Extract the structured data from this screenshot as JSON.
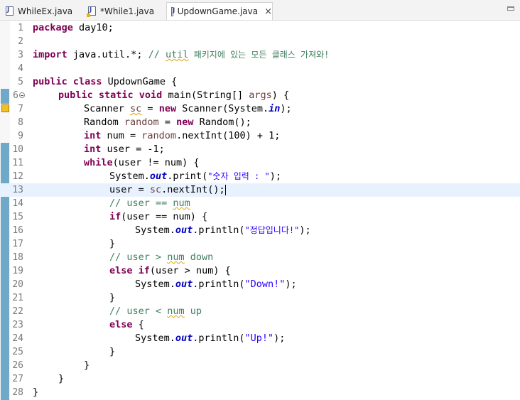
{
  "tabs": [
    {
      "label": "WhileEx.java"
    },
    {
      "label": "*While1.java"
    },
    {
      "label": "UpdownGame.java",
      "close": "×"
    }
  ],
  "lines": [
    "1",
    "2",
    "3",
    "4",
    "5",
    "6",
    "7",
    "8",
    "9",
    "10",
    "11",
    "12",
    "13",
    "14",
    "15",
    "16",
    "17",
    "18",
    "19",
    "20",
    "21",
    "22",
    "23",
    "24",
    "25",
    "26",
    "27",
    "28"
  ],
  "code": {
    "l1_kw": "package",
    "l1_rest": " day10;",
    "l3_kw": "import",
    "l3_rest": " java.util.*; ",
    "l3_c1": "// ",
    "l3_c2": "util",
    "l3_c3": " 패키지에 있는 모든 클래스 가져와!",
    "l5_kw": "public class",
    "l5_rest": " UpdownGame {",
    "l6_kw1": "public static void",
    "l6_rest1": " main(String[] ",
    "l6_var": "args",
    "l6_rest2": ") {",
    "l7_a": "Scanner ",
    "l7_var": "sc",
    "l7_b": " = ",
    "l7_kw": "new",
    "l7_c": " Scanner(System.",
    "l7_field": "in",
    "l7_d": ");",
    "l8_a": "Random ",
    "l8_var": "random",
    "l8_b": " = ",
    "l8_kw": "new",
    "l8_c": " Random();",
    "l9_kw": "int",
    "l9_a": " num = ",
    "l9_var": "random",
    "l9_b": ".nextInt(100) + 1;",
    "l10_kw": "int",
    "l10_a": " user = -1;",
    "l11_kw": "while",
    "l11_a": "(user != num) {",
    "l12_a": "System.",
    "l12_field": "out",
    "l12_b": ".print(",
    "l12_str": "\"숫자 입력 : \"",
    "l12_c": ");",
    "l13_a": "user = ",
    "l13_var": "sc",
    "l13_b": ".nextInt();",
    "l14_c1": "// user == ",
    "l14_c2": "num",
    "l15_kw": "if",
    "l15_a": "(user == num) {",
    "l16_a": "System.",
    "l16_field": "out",
    "l16_b": ".println(",
    "l16_str": "\"정답입니다!\"",
    "l16_c": ");",
    "l17": "}",
    "l18_c1": "// user > ",
    "l18_c2": "num",
    "l18_c3": " down",
    "l19_kw1": "else",
    "l19_sp": " ",
    "l19_kw2": "if",
    "l19_a": "(user > num) {",
    "l20_a": "System.",
    "l20_field": "out",
    "l20_b": ".println(",
    "l20_str": "\"Down!\"",
    "l20_c": ");",
    "l21": "}",
    "l22_c1": "// user < ",
    "l22_c2": "num",
    "l22_c3": " up",
    "l23_kw": "else",
    "l23_a": " {",
    "l24_a": "System.",
    "l24_field": "out",
    "l24_b": ".println(",
    "l24_str": "\"Up!\"",
    "l24_c": ");",
    "l25": "}",
    "l26": "}",
    "l27": "}",
    "l28": "}"
  }
}
